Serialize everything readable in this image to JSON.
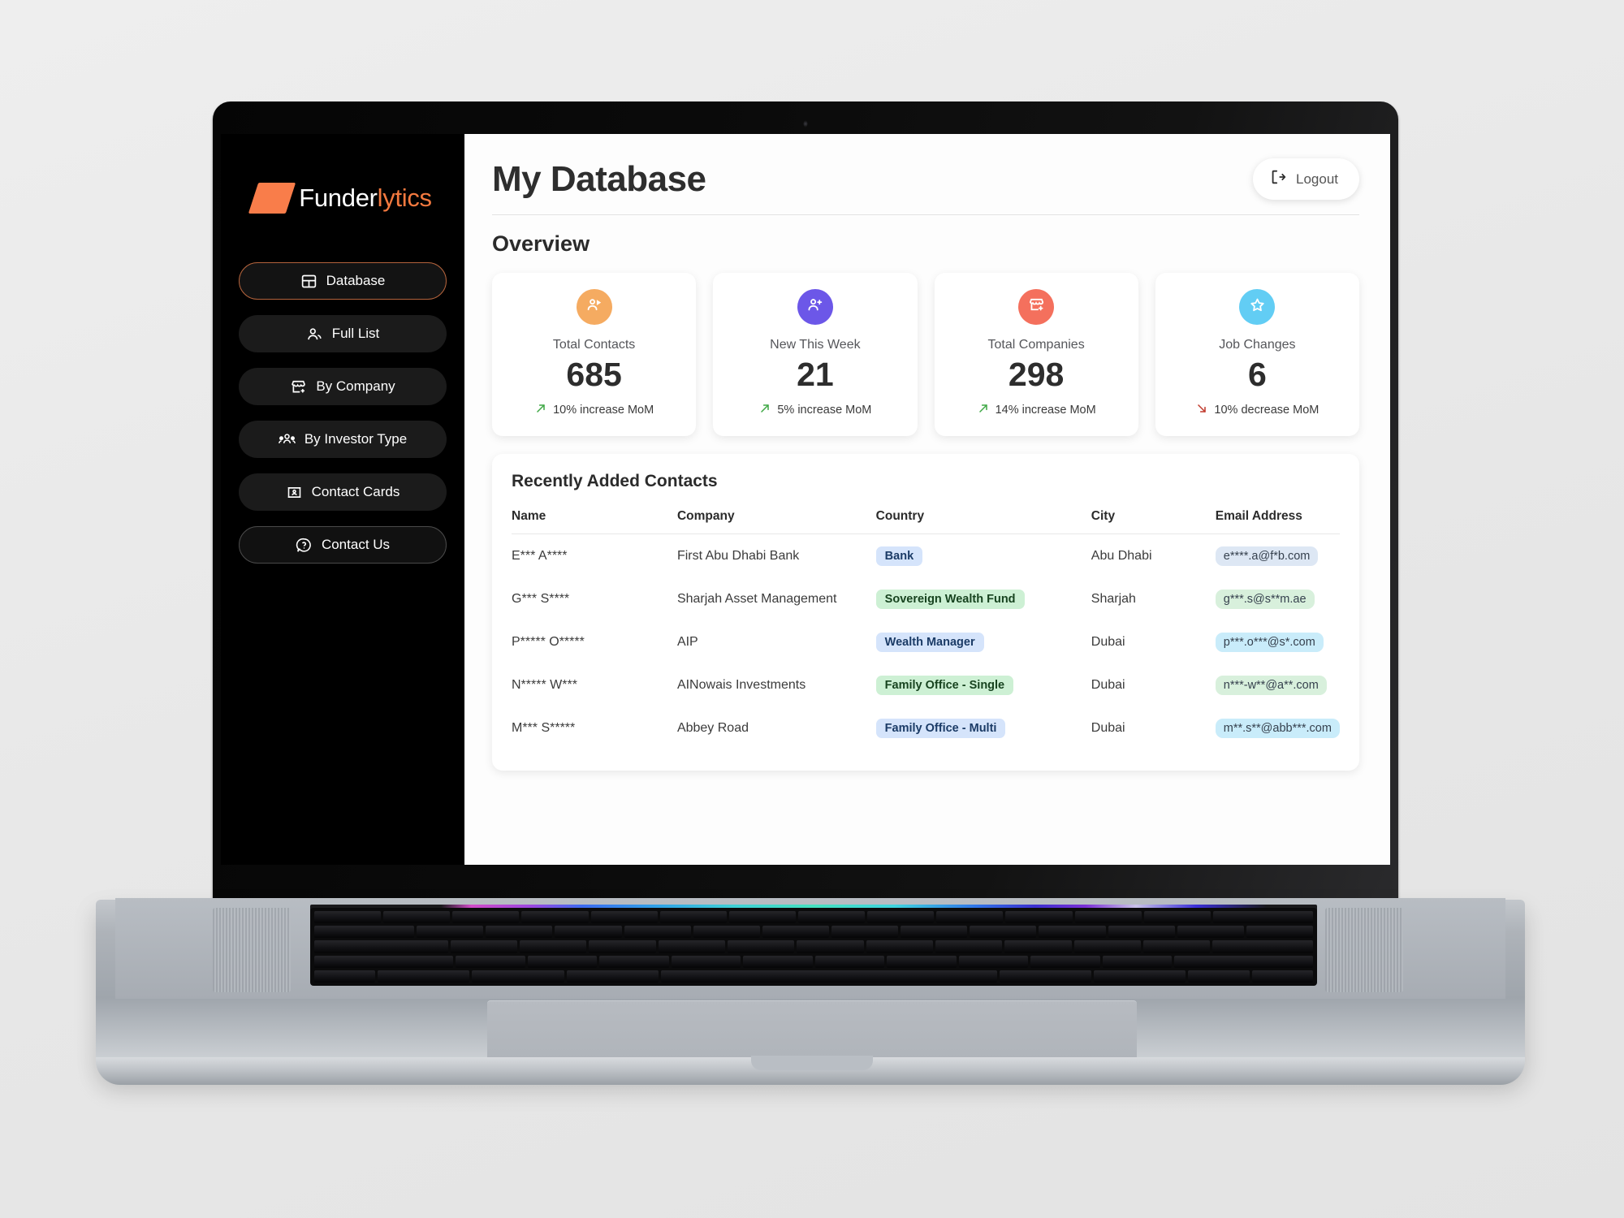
{
  "app": {
    "brand": {
      "primary": "Funder",
      "secondary": "lytics",
      "accent": "#f3793f"
    }
  },
  "sidebar": {
    "items": [
      {
        "label": "Database",
        "icon": "layout-dashboard-icon",
        "state": "active"
      },
      {
        "label": "Full List",
        "icon": "users-icon",
        "state": "default"
      },
      {
        "label": "By Company",
        "icon": "store-plus-icon",
        "state": "default"
      },
      {
        "label": "By Investor Type",
        "icon": "users-group-icon",
        "state": "default"
      },
      {
        "label": "Contact Cards",
        "icon": "id-card-icon",
        "state": "default"
      },
      {
        "label": "Contact Us",
        "icon": "help-circle-icon",
        "state": "outlined"
      }
    ]
  },
  "header": {
    "title": "My Database",
    "logout_label": "Logout",
    "logout_icon": "logout-icon"
  },
  "overview": {
    "title": "Overview",
    "cards": [
      {
        "label": "Total Contacts",
        "value": "685",
        "delta": "10% increase MoM",
        "trend": "up",
        "icon": "contacts-icon",
        "icon_bg": "#f5ab61",
        "delta_color": "#3fa845"
      },
      {
        "label": "New This Week",
        "value": "21",
        "delta": "5% increase MoM",
        "trend": "up",
        "icon": "user-plus-icon",
        "icon_bg": "#6c57e8",
        "delta_color": "#3fa845"
      },
      {
        "label": "Total Companies",
        "value": "298",
        "delta": "14% increase MoM",
        "trend": "up",
        "icon": "store-plus-icon",
        "icon_bg": "#f4705d",
        "delta_color": "#3fa845"
      },
      {
        "label": "Job Changes",
        "value": "6",
        "delta": "10% decrease MoM",
        "trend": "down",
        "icon": "star-icon",
        "icon_bg": "#62cdf4",
        "delta_color": "#c0392b"
      }
    ]
  },
  "table": {
    "title": "Recently Added Contacts",
    "columns": [
      "Name",
      "Company",
      "Country",
      "City",
      "Email Address"
    ],
    "rows": [
      {
        "name": "E*** A****",
        "company": "First Abu Dhabi Bank",
        "type": "Bank",
        "type_color": "blue",
        "city": "Abu Dhabi",
        "email": "e****.a@f*b.com",
        "email_color": "blue"
      },
      {
        "name": "G*** S****",
        "company": "Sharjah Asset Management",
        "type": "Sovereign Wealth Fund",
        "type_color": "green",
        "city": "Sharjah",
        "email": "g***.s@s**m.ae",
        "email_color": "green"
      },
      {
        "name": "P***** O*****",
        "company": "AIP",
        "type": "Wealth Manager",
        "type_color": "blue",
        "city": "Dubai",
        "email": "p***.o***@s*.com",
        "email_color": "cyan"
      },
      {
        "name": "N***** W***",
        "company": "AINowais Investments",
        "type": "Family Office - Single",
        "type_color": "green",
        "city": "Dubai",
        "email": "n***-w**@a**.com",
        "email_color": "green"
      },
      {
        "name": "M*** S*****",
        "company": "Abbey Road",
        "type": "Family Office - Multi",
        "type_color": "blue",
        "city": "Dubai",
        "email": "m**.s**@abb***.com",
        "email_color": "cyan"
      }
    ]
  }
}
